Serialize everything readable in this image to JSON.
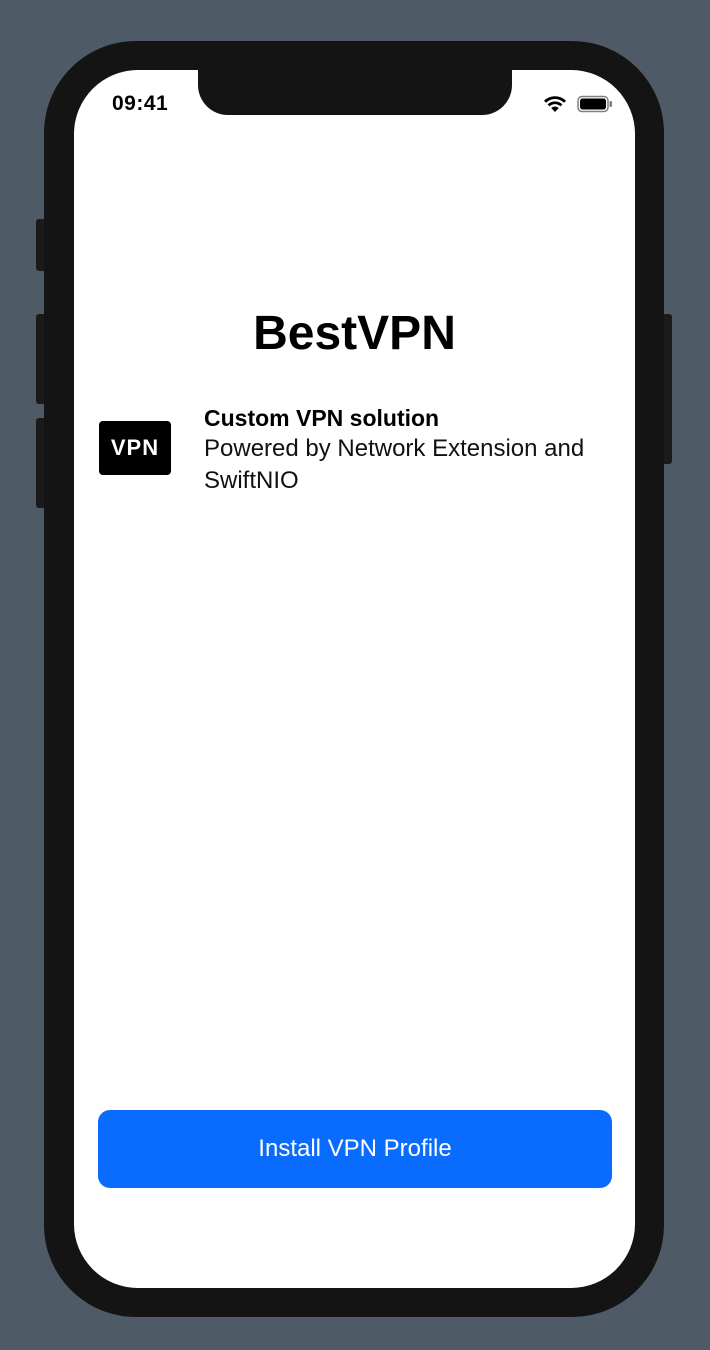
{
  "status_bar": {
    "time": "09:41",
    "icons": [
      "wifi-icon",
      "battery-icon"
    ]
  },
  "app": {
    "title": "BestVPN",
    "feature": {
      "badge": "VPN",
      "title": "Custom VPN solution",
      "description": "Powered by Network Extension and SwiftNIO"
    },
    "install_button": "Install VPN Profile"
  },
  "colors": {
    "background": "#4f5a67",
    "phone_frame": "#141414",
    "accent": "#0a6cff"
  }
}
